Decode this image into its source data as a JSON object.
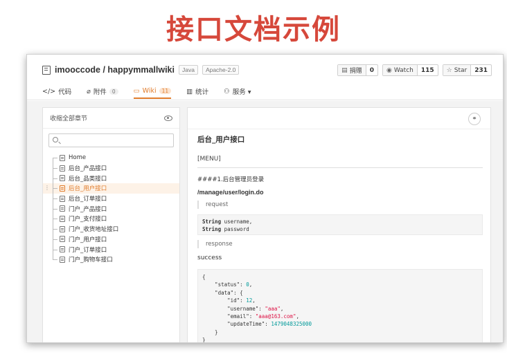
{
  "slide": {
    "title": "接口文档示例"
  },
  "repo": {
    "name": "imooccode / happymmallwiki",
    "tags": [
      "Java",
      "Apache-2.0"
    ],
    "actions": [
      {
        "icon": "donate-icon",
        "label": "捐赠",
        "count": "0"
      },
      {
        "icon": "eye-icon",
        "label": "Watch",
        "count": "115"
      },
      {
        "icon": "star-icon",
        "label": "Star",
        "count": "231"
      }
    ]
  },
  "tabs": [
    {
      "icon": "code-icon",
      "label": "代码",
      "badge": "",
      "active": false
    },
    {
      "icon": "attachment-icon",
      "label": "附件",
      "badge": "0",
      "active": false
    },
    {
      "icon": "wiki-icon",
      "label": "Wiki",
      "badge": "11",
      "active": true
    },
    {
      "icon": "stats-icon",
      "label": "统计",
      "badge": "",
      "active": false
    },
    {
      "icon": "services-icon",
      "label": "服务 ▾",
      "badge": "",
      "active": false
    }
  ],
  "sidebar": {
    "collapse_label": "收缩全部章节",
    "search_placeholder": "",
    "items": [
      {
        "label": "Home",
        "active": false
      },
      {
        "label": "后台_产品接口",
        "active": false
      },
      {
        "label": "后台_品类接口",
        "active": false
      },
      {
        "label": "后台_用户接口",
        "active": true
      },
      {
        "label": "后台_订单接口",
        "active": false
      },
      {
        "label": "门户_产品接口",
        "active": false
      },
      {
        "label": "门户_支付接口",
        "active": false
      },
      {
        "label": "门户_收货地址接口",
        "active": false
      },
      {
        "label": "门户_用户接口",
        "active": false
      },
      {
        "label": "门户_订单接口",
        "active": false
      },
      {
        "label": "门户_购物车接口",
        "active": false
      }
    ]
  },
  "doc": {
    "title": "后台_用户接口",
    "menu": "[MENU]",
    "api_heading": "####1.后台管理员登录",
    "path": "/manage/user/login.do",
    "request_label": "request",
    "request_code": [
      {
        "type": "String",
        "name": "username,"
      },
      {
        "type": "String",
        "name": "password"
      }
    ],
    "response_label": "response",
    "success_label": "success",
    "response_json": {
      "status": "0",
      "id": "12",
      "username": "\"aaa\"",
      "email": "\"aaa@163.com\"",
      "updateTime": "1479048325000"
    }
  }
}
